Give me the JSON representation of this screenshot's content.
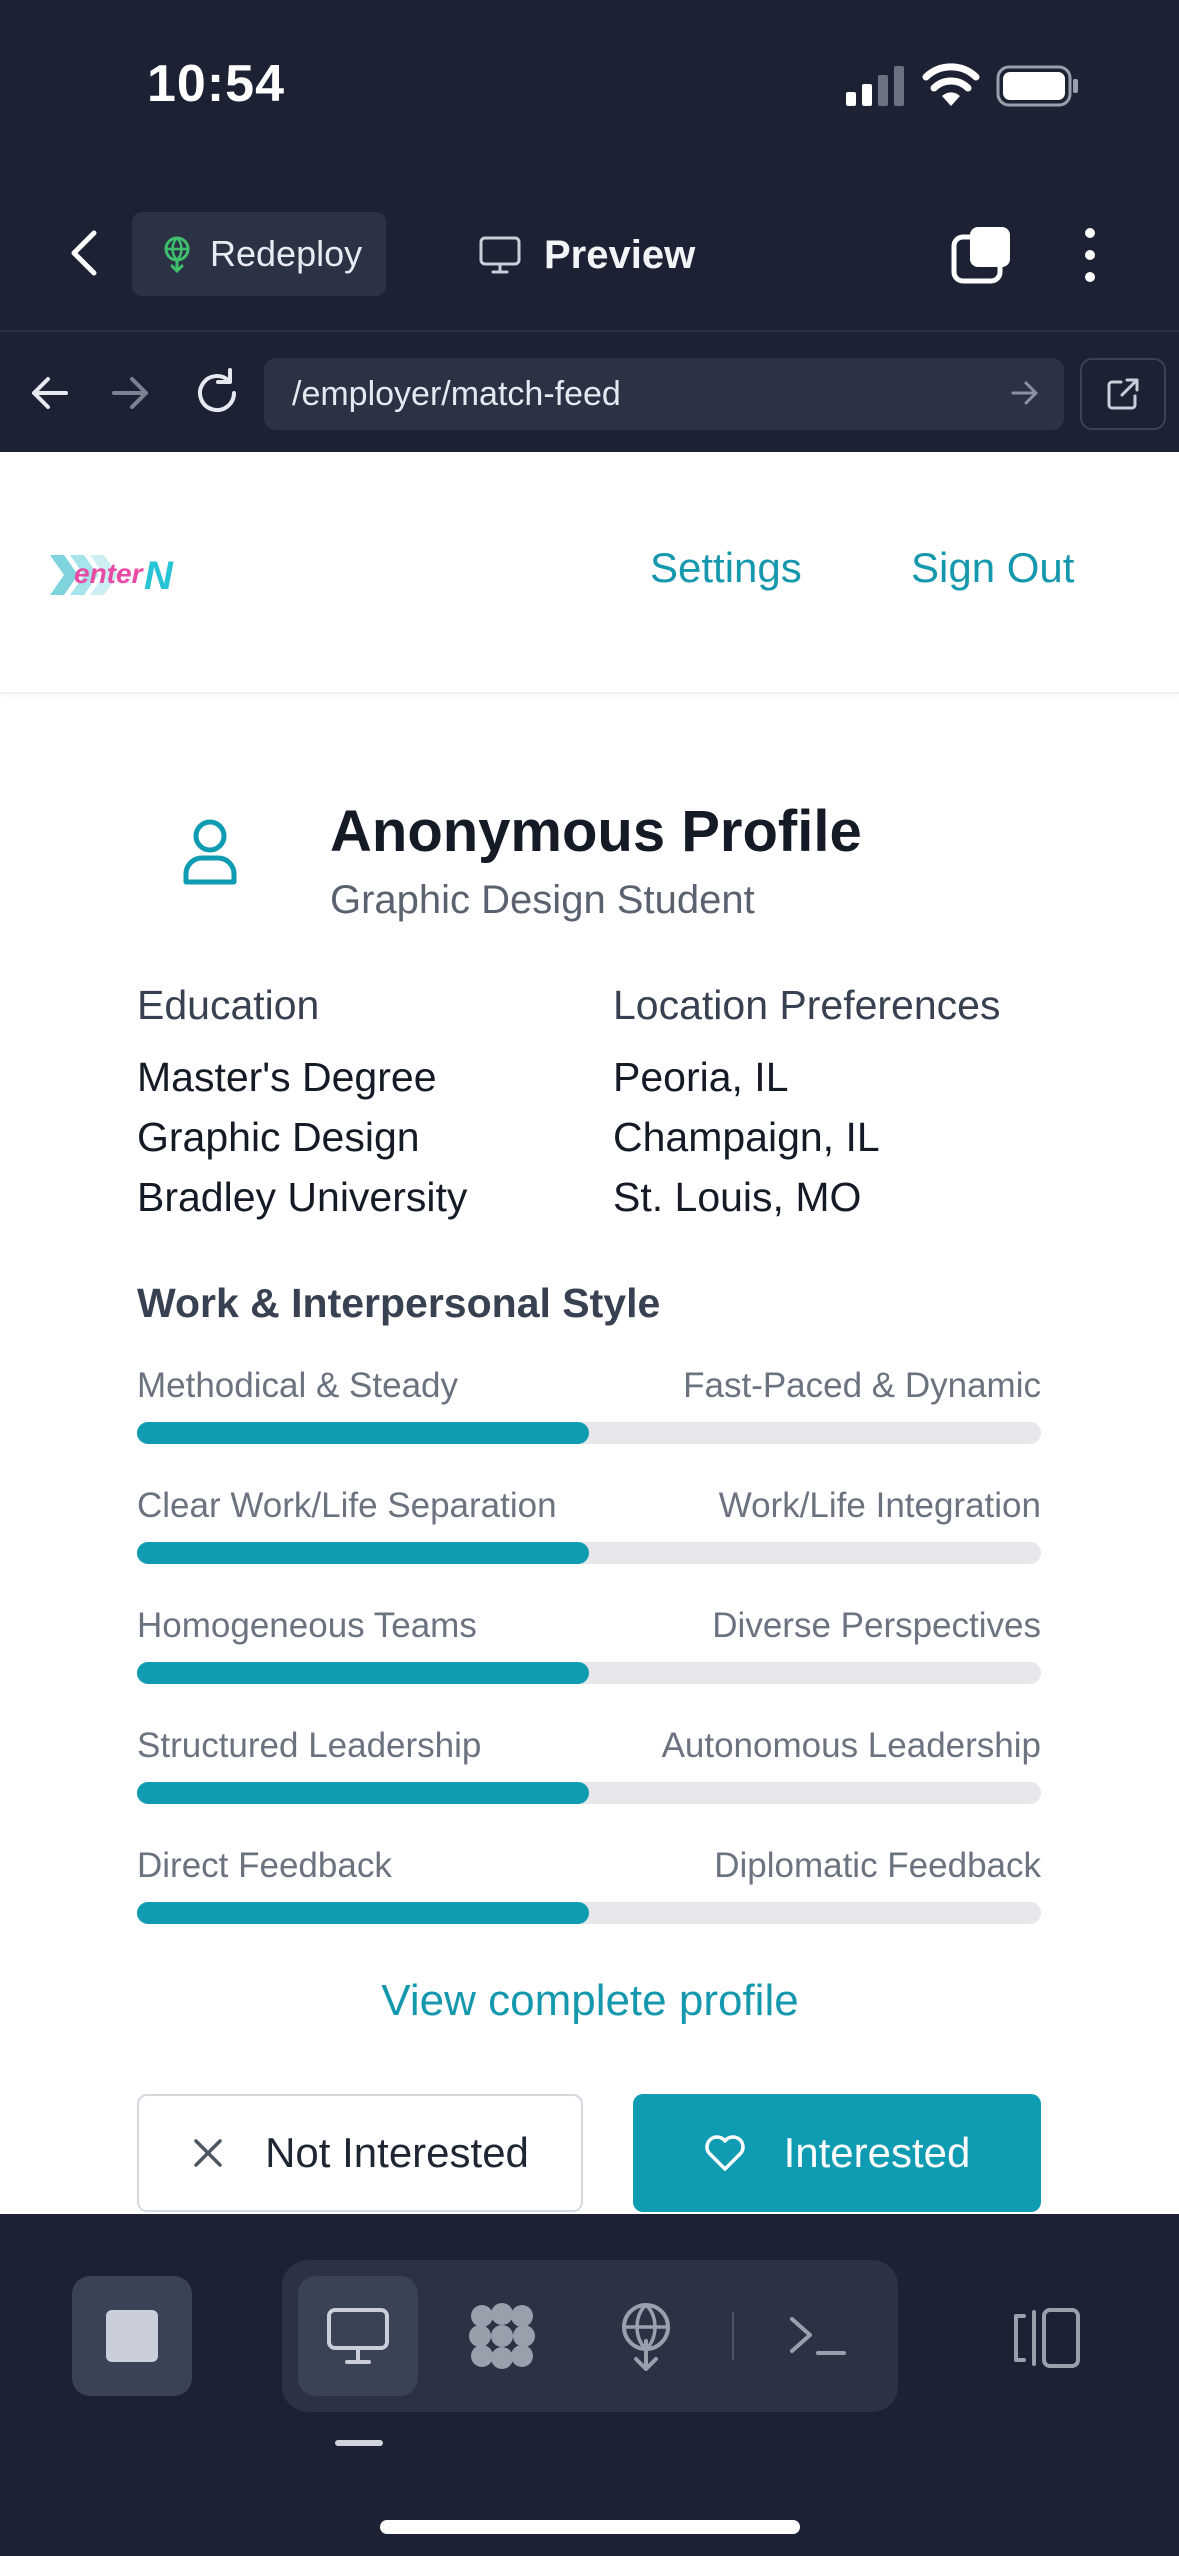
{
  "status_bar": {
    "time": "10:54"
  },
  "toolbar": {
    "redeploy_label": "Redeploy",
    "preview_label": "Preview"
  },
  "urlbar": {
    "url": "/employer/match-feed"
  },
  "header": {
    "logo_text": "enterN",
    "settings_label": "Settings",
    "signout_label": "Sign Out"
  },
  "profile": {
    "title": "Anonymous Profile",
    "subtitle": "Graphic Design Student",
    "education_heading": "Education",
    "education": [
      "Master's Degree",
      "Graphic Design",
      "Bradley University"
    ],
    "location_heading": "Location Preferences",
    "locations": [
      "Peoria, IL",
      "Champaign, IL",
      "St. Louis, MO"
    ],
    "style_heading": "Work & Interpersonal Style",
    "traits": [
      {
        "left": "Methodical & Steady",
        "right": "Fast-Paced & Dynamic",
        "value": 0.5
      },
      {
        "left": "Clear Work/Life Separation",
        "right": "Work/Life Integration",
        "value": 0.5
      },
      {
        "left": "Homogeneous Teams",
        "right": "Diverse Perspectives",
        "value": 0.5
      },
      {
        "left": "Structured Leadership",
        "right": "Autonomous Leadership",
        "value": 0.5
      },
      {
        "left": "Direct Feedback",
        "right": "Diplomatic Feedback",
        "value": 0.5
      }
    ],
    "view_link": "View complete profile",
    "not_interested_label": "Not Interested",
    "interested_label": "Interested"
  },
  "colors": {
    "accent": "#0f9bb1",
    "chrome": "#1c2233",
    "track": "#e5e7eb"
  }
}
